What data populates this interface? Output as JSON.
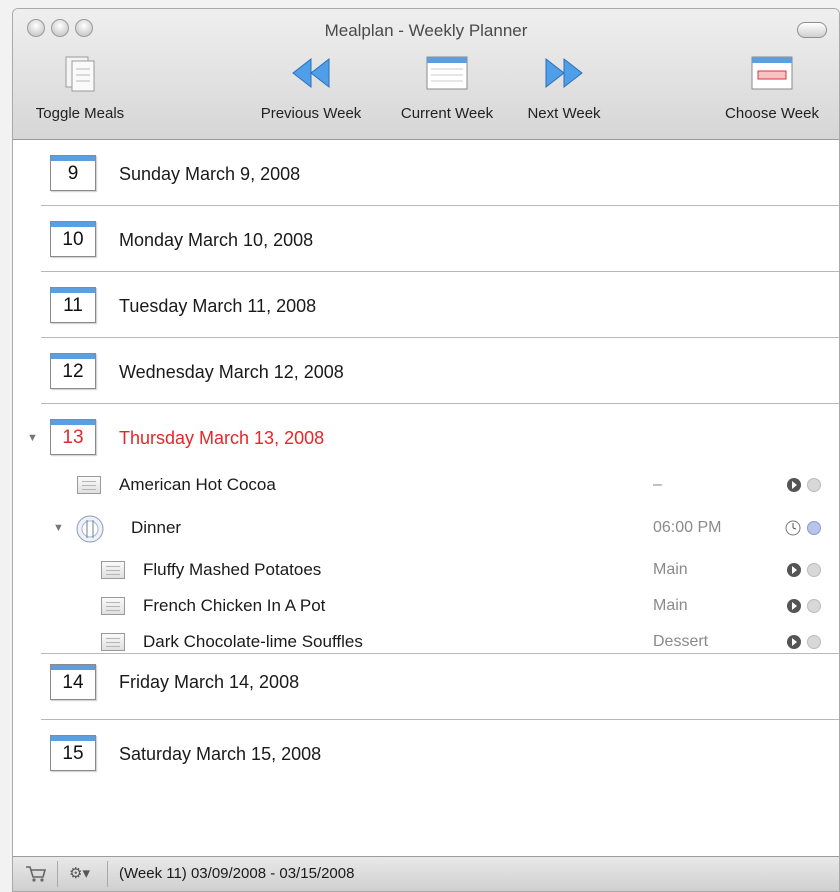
{
  "window": {
    "title": "Mealplan - Weekly Planner"
  },
  "toolbar": {
    "toggle_meals": "Toggle Meals",
    "previous_week": "Previous Week",
    "current_week": "Current Week",
    "next_week": "Next Week",
    "choose_week": "Choose Week"
  },
  "days": [
    {
      "num": "9",
      "label": "Sunday March 9, 2008"
    },
    {
      "num": "10",
      "label": "Monday March 10, 2008"
    },
    {
      "num": "11",
      "label": "Tuesday March 11, 2008"
    },
    {
      "num": "12",
      "label": "Wednesday March 12, 2008"
    },
    {
      "num": "13",
      "label": "Thursday March 13, 2008",
      "today": true
    },
    {
      "num": "14",
      "label": "Friday March 14, 2008"
    },
    {
      "num": "15",
      "label": "Saturday March 15, 2008"
    }
  ],
  "thursday": {
    "cocoa": {
      "name": "American Hot Cocoa",
      "course": "–"
    },
    "dinner": {
      "name": "Dinner",
      "time": "06:00 PM"
    },
    "items": [
      {
        "name": "Fluffy Mashed Potatoes",
        "course": "Main"
      },
      {
        "name": "French Chicken In A Pot",
        "course": "Main"
      },
      {
        "name": "Dark Chocolate-lime Souffles",
        "course": "Dessert"
      }
    ]
  },
  "status": {
    "week_range": "(Week 11) 03/09/2008 - 03/15/2008"
  },
  "colors": {
    "today": "#e8262a",
    "calendar_bar": "#5b9fe0"
  }
}
